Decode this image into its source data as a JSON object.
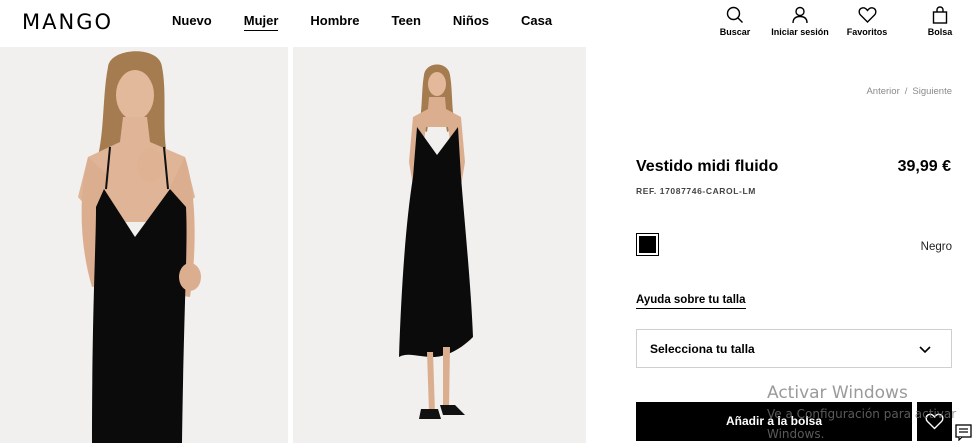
{
  "header": {
    "logo": "MANGO",
    "nav": [
      {
        "label": "Nuevo",
        "active": false
      },
      {
        "label": "Mujer",
        "active": true
      },
      {
        "label": "Hombre",
        "active": false
      },
      {
        "label": "Teen",
        "active": false
      },
      {
        "label": "Niños",
        "active": false
      },
      {
        "label": "Casa",
        "active": false
      }
    ],
    "actions": [
      {
        "label": "Buscar",
        "icon": "search-icon"
      },
      {
        "label": "Iniciar sesión",
        "icon": "user-icon"
      },
      {
        "label": "Favoritos",
        "icon": "heart-icon"
      },
      {
        "label": "Bolsa",
        "icon": "bag-icon"
      }
    ]
  },
  "breadcrumb": {
    "prev": "Anterior",
    "sep": "/",
    "next": "Siguiente"
  },
  "product": {
    "title": "Vestido midi fluido",
    "price": "39,99 €",
    "ref": "REF. 17087746-CAROL-LM",
    "color": {
      "name": "Negro",
      "swatch": "#000000"
    },
    "size_help": "Ayuda sobre tu talla",
    "size_select": "Selecciona tu talla",
    "add_to_bag": "Añadir a la bolsa"
  },
  "watermark": {
    "line1": "Activar Windows",
    "line2": "Ve a Configuración para activar",
    "line3": "Windows."
  }
}
